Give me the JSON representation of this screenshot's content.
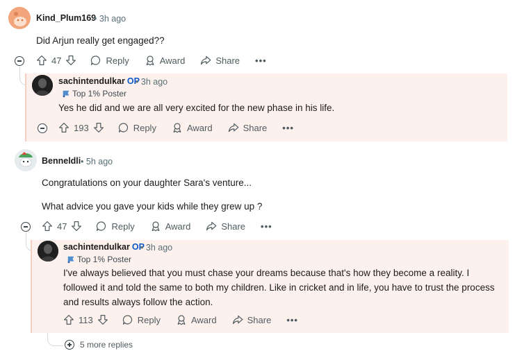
{
  "comments": [
    {
      "user": "Kind_Plum169",
      "time": "3h ago",
      "text": "Did Arjun really get engaged??",
      "votes": "47"
    },
    {
      "user": "sachintendulkar",
      "op": "OP",
      "time": "3h ago",
      "flair": "Top 1% Poster",
      "text": "Yes he did and we are all very excited for the new phase in his life.",
      "votes": "193"
    },
    {
      "user": "Benneldli",
      "time": "5h ago",
      "text_1": "Congratulations on your daughter Sara's venture...",
      "text_2": "What advice you gave your kids while they grew up ?",
      "votes": "47"
    },
    {
      "user": "sachintendulkar",
      "op": "OP",
      "time": "3h ago",
      "flair": "Top 1% Poster",
      "lines": [
        "I've always believed that you must chase your dreams because that's how they become a reality. I",
        "followed it and told the same to both my children. Like in cricket and in life, you have to trust the process",
        "and results always follow the action."
      ],
      "votes": "113"
    }
  ],
  "labels": {
    "reply": "Reply",
    "award": "Award",
    "share": "Share",
    "overflow": "•••",
    "sep": "•",
    "more_replies": "5 more replies"
  },
  "colors": {
    "op": "#0a58ca",
    "highlight_bg": "#fdf1ed",
    "meta": "#576f76"
  },
  "icons": [
    "upvote-icon",
    "downvote-icon",
    "reply-icon",
    "award-icon",
    "share-icon",
    "flair-icon",
    "collapse-icon",
    "expand-icon"
  ]
}
